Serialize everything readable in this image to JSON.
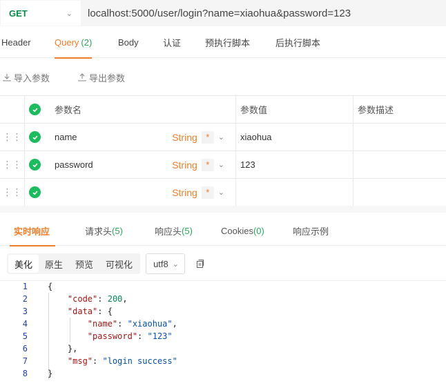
{
  "request": {
    "method": "GET",
    "url": "localhost:5000/user/login?name=xiaohua&password=123"
  },
  "req_tabs": [
    {
      "label": "Header",
      "count": ""
    },
    {
      "label": "Query",
      "count": "(2)"
    },
    {
      "label": "Body",
      "count": ""
    },
    {
      "label": "认证",
      "count": ""
    },
    {
      "label": "预执行脚本",
      "count": ""
    },
    {
      "label": "后执行脚本",
      "count": ""
    }
  ],
  "actions": {
    "import_label": "导入参数",
    "export_label": "导出参数"
  },
  "params": {
    "headers": {
      "name": "参数名",
      "value": "参数值",
      "desc": "参数描述"
    },
    "rows": [
      {
        "name": "name",
        "type": "String",
        "required": "*",
        "value": "xiaohua",
        "desc": ""
      },
      {
        "name": "password",
        "type": "String",
        "required": "*",
        "value": "123",
        "desc": ""
      },
      {
        "name": "",
        "type": "String",
        "required": "*",
        "value": "",
        "desc": ""
      }
    ]
  },
  "resp_tabs": [
    {
      "label": "实时响应",
      "count": ""
    },
    {
      "label": "请求头",
      "count": "(5)"
    },
    {
      "label": "响应头",
      "count": "(5)"
    },
    {
      "label": "Cookies",
      "count": "(0)"
    },
    {
      "label": "响应示例",
      "count": ""
    }
  ],
  "viewer": {
    "modes": [
      "美化",
      "原生",
      "预览",
      "可视化"
    ],
    "encoding": "utf8"
  },
  "response_body": [
    {
      "n": "1",
      "text": "{"
    },
    {
      "n": "2",
      "text": "    \"code\": 200,"
    },
    {
      "n": "3",
      "text": "    \"data\": {"
    },
    {
      "n": "4",
      "text": "        \"name\": \"xiaohua\","
    },
    {
      "n": "5",
      "text": "        \"password\": \"123\""
    },
    {
      "n": "6",
      "text": "    },"
    },
    {
      "n": "7",
      "text": "    \"msg\": \"login success\""
    },
    {
      "n": "8",
      "text": "}"
    }
  ],
  "colors": {
    "accent": "#f07d29",
    "success": "#1dbb5d",
    "count": "#2aa65c",
    "method": "#0e8a4a"
  }
}
